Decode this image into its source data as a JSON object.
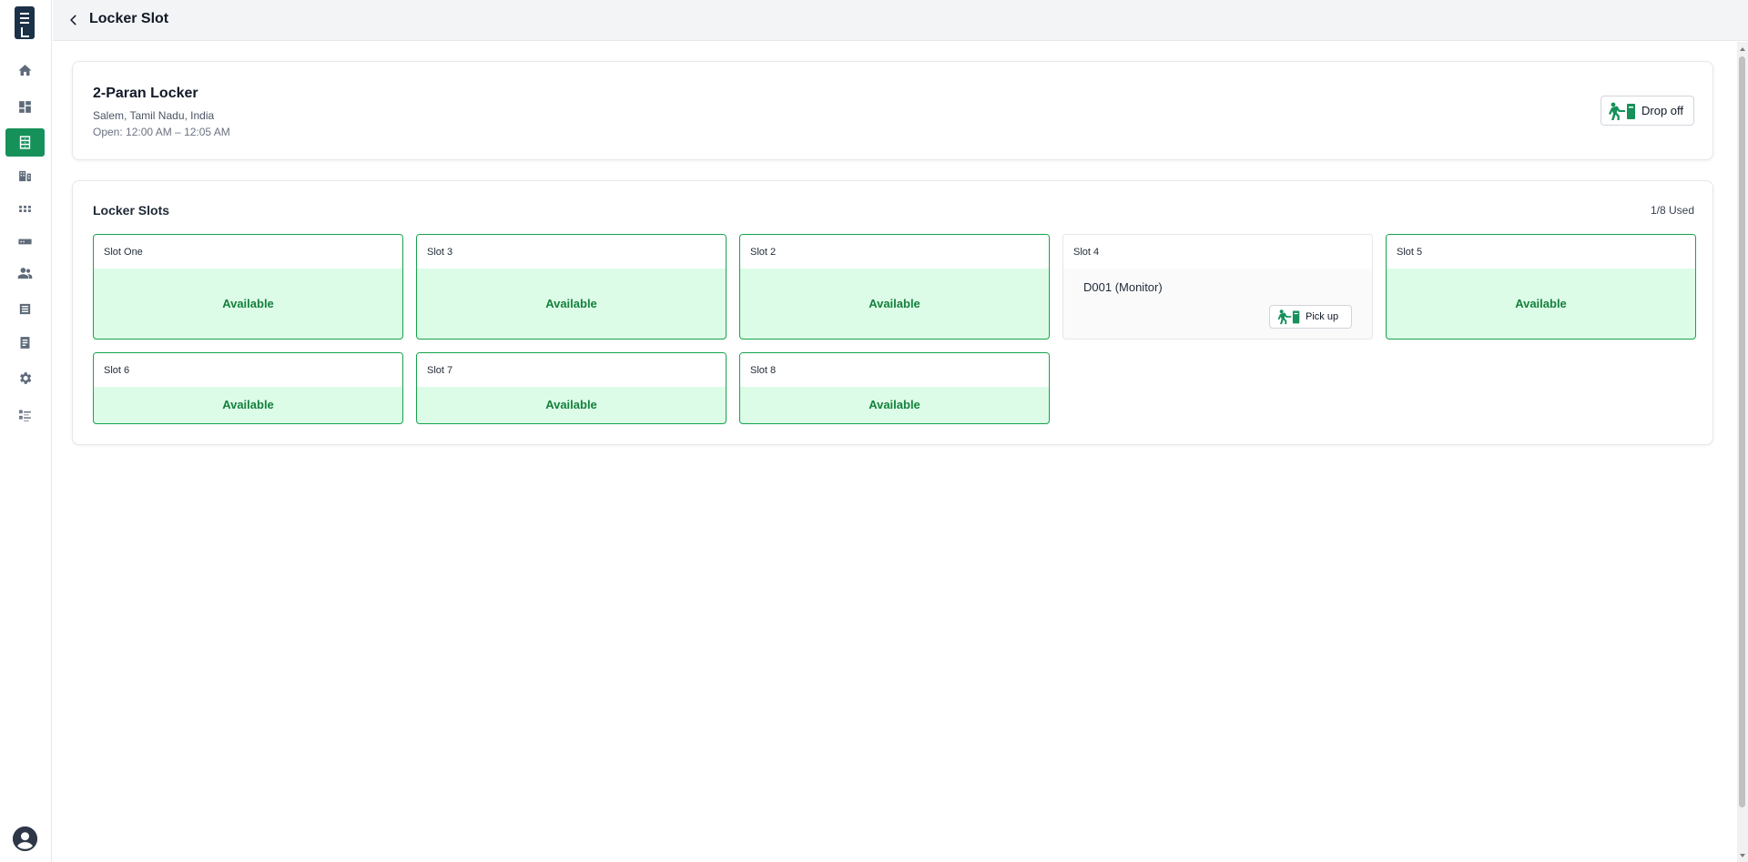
{
  "header": {
    "title": "Locker Slot"
  },
  "sidebar": {
    "items": [
      {
        "icon": "home-icon"
      },
      {
        "icon": "dashboard-icon"
      },
      {
        "icon": "locker-icon",
        "active": true
      },
      {
        "icon": "building-icon"
      },
      {
        "icon": "grid-icon"
      },
      {
        "icon": "device-icon"
      },
      {
        "icon": "users-icon"
      },
      {
        "icon": "list-icon"
      },
      {
        "icon": "document-icon"
      },
      {
        "icon": "gear-icon"
      },
      {
        "icon": "checklist-icon"
      }
    ],
    "profile_icon": "account-icon"
  },
  "locker": {
    "name": "2-Paran Locker",
    "location": "Salem, Tamil Nadu, India",
    "hours": "Open: 12:00 AM – 12:05 AM",
    "drop_off_label": "Drop off"
  },
  "slots_section": {
    "title": "Locker Slots",
    "used": "1/8 Used",
    "slots": [
      {
        "name": "Slot One",
        "status": "Available"
      },
      {
        "name": "Slot 3",
        "status": "Available"
      },
      {
        "name": "Slot 2",
        "status": "Available"
      },
      {
        "name": "Slot 4",
        "item": "D001 (Monitor)",
        "pickup_label": "Pick up"
      },
      {
        "name": "Slot 5",
        "status": "Available"
      },
      {
        "name": "Slot 6",
        "status": "Available"
      },
      {
        "name": "Slot 7",
        "status": "Available"
      },
      {
        "name": "Slot 8",
        "status": "Available"
      }
    ]
  },
  "colors": {
    "accent": "#16915a",
    "available_bg": "#dcfce7",
    "available_border": "#16a34a",
    "logo": "#1b3147"
  }
}
